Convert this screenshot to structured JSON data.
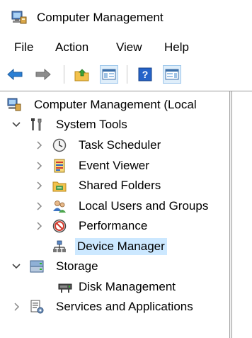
{
  "window": {
    "title": "Computer Management"
  },
  "menu": [
    "File",
    "Action",
    "View",
    "Help"
  ],
  "toolbar": {
    "buttons": [
      "back-icon",
      "forward-icon",
      "up-folder-icon",
      "show-hide-console-tree-icon",
      "help-icon",
      "action-pane-icon"
    ]
  },
  "tree": {
    "root": {
      "label": "Computer Management (Local",
      "icon": "computer-management-icon"
    },
    "system_tools": {
      "label": "System Tools",
      "icon": "tools-icon",
      "expanded": true
    },
    "task_scheduler": {
      "label": "Task Scheduler",
      "icon": "clock-icon"
    },
    "event_viewer": {
      "label": "Event Viewer",
      "icon": "event-viewer-icon"
    },
    "shared_folders": {
      "label": "Shared Folders",
      "icon": "shared-folders-icon"
    },
    "local_users": {
      "label": "Local Users and Groups",
      "icon": "users-icon"
    },
    "performance": {
      "label": "Performance",
      "icon": "performance-icon"
    },
    "device_manager": {
      "label": "Device Manager",
      "icon": "device-manager-icon",
      "selected": true
    },
    "storage": {
      "label": "Storage",
      "icon": "storage-icon",
      "expanded": true
    },
    "disk_management": {
      "label": "Disk Management",
      "icon": "disk-icon"
    },
    "services": {
      "label": "Services and Applications",
      "icon": "services-icon"
    }
  },
  "colors": {
    "selection": "#cce8ff",
    "accent": "#1e78d2"
  }
}
